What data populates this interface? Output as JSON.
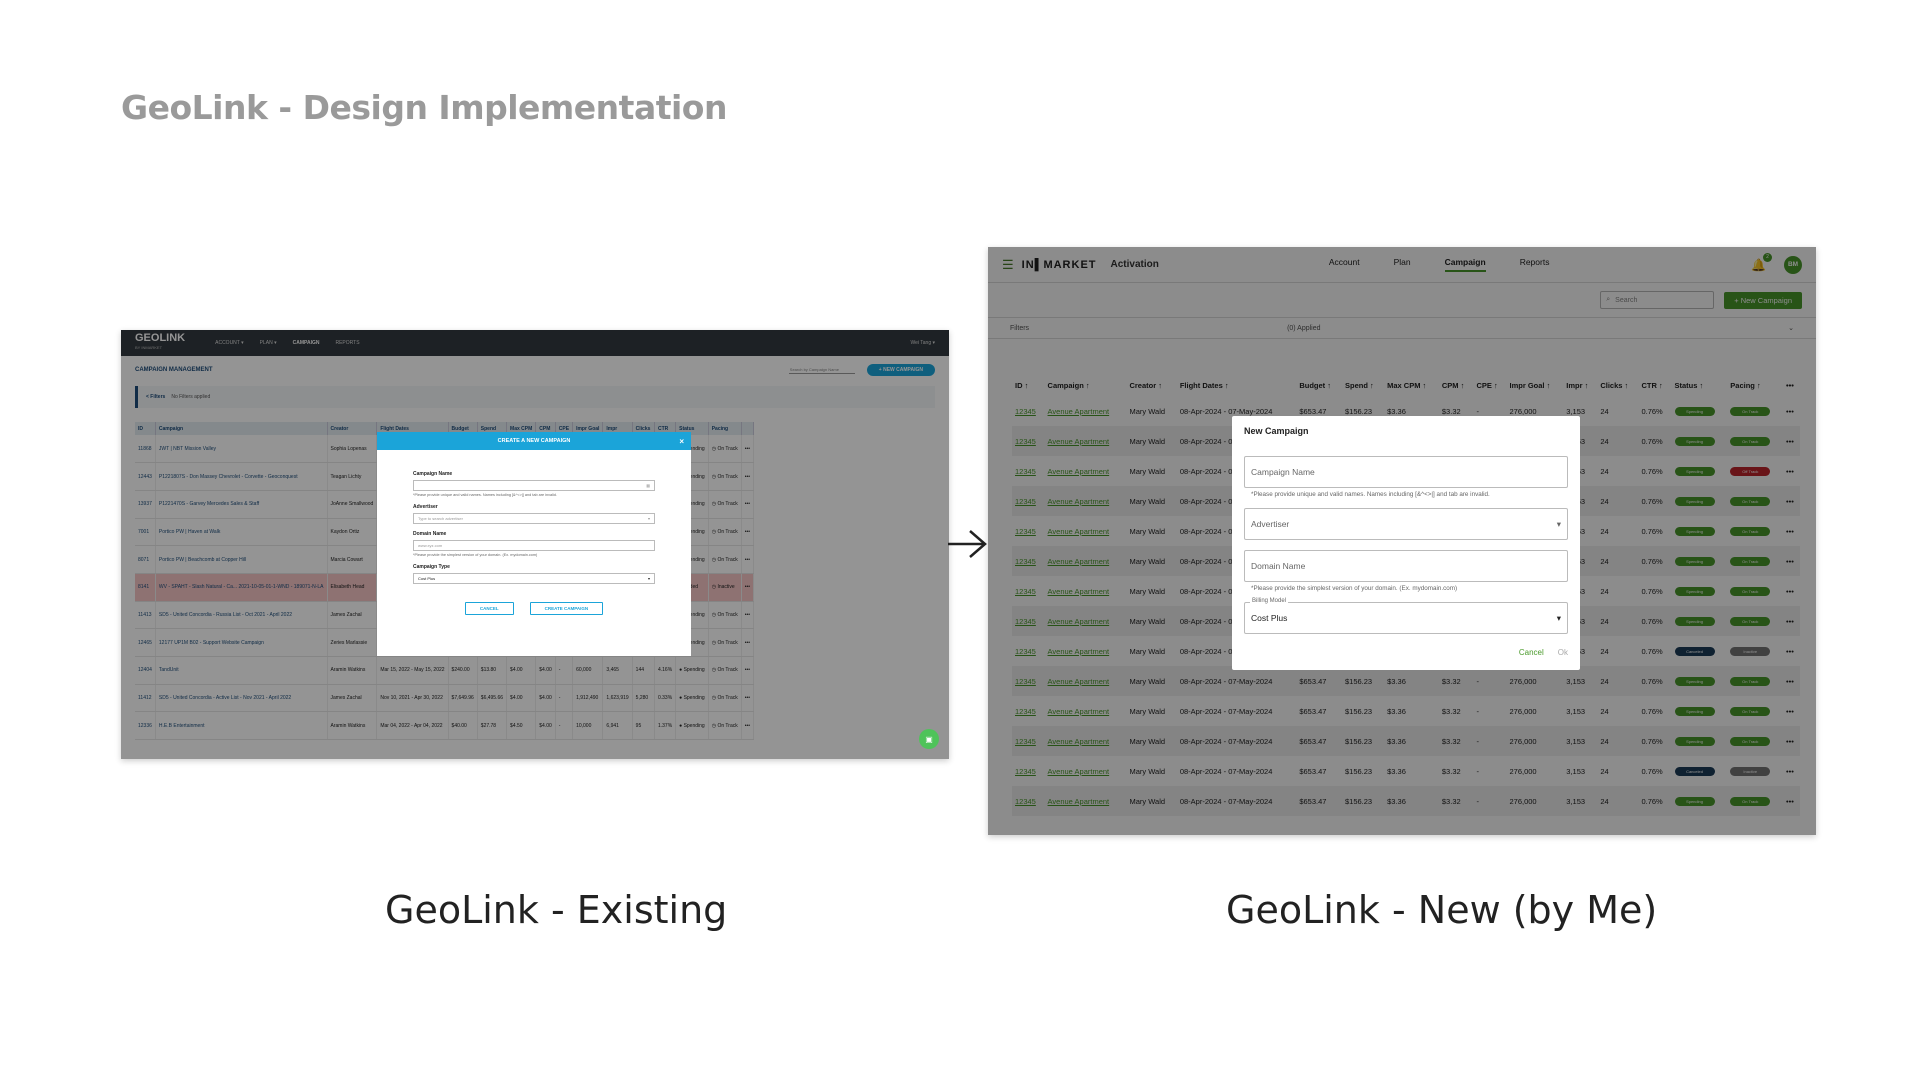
{
  "slide": {
    "title": "GeoLink - Design Implementation",
    "caption_left": "GeoLink - Existing",
    "caption_right": "GeoLink - New (by Me)"
  },
  "old": {
    "logo": "GEOLINK",
    "logo_sub": "BY INMARKET",
    "nav": [
      "ACCOUNT ▾",
      "PLAN ▾",
      "CAMPAIGN",
      "REPORTS"
    ],
    "user": "Wei Tang ▾",
    "section_title": "CAMPAIGN MANAGEMENT",
    "search_placeholder": "Search by Campaign Name",
    "new_button": "+ NEW CAMPAIGN",
    "filters_label": "< Filters",
    "filters_value": "No Filters applied",
    "columns": [
      "ID",
      "Campaign",
      "Creator",
      "Flight Dates",
      "Budget",
      "Spend",
      "Max CPM",
      "CPM",
      "CPE",
      "Impr Goal",
      "Impr",
      "Clicks",
      "CTR",
      "Status",
      "Pacing",
      ""
    ],
    "rows": [
      [
        "11868",
        "JWT | NBT Mission Valley",
        "Sophia Lopenas",
        "Jan 01, 2022 - Mar 31, 2022",
        "",
        "",
        "",
        "",
        "",
        "",
        "",
        "536",
        "0.06%",
        "● Spending",
        "◷ On Track",
        "•••"
      ],
      [
        "12443",
        "P1221807S - Don Massey Chevrolet - Corvette - Geoconquest",
        "Teagan Lichty",
        "Mar 23, 2022 - Mar 31, 2022",
        "",
        "",
        "",
        "",
        "",
        "",
        "",
        "312",
        "1.12%",
        "● Spending",
        "◷ On Track",
        "•••"
      ],
      [
        "13937",
        "P1221470S - Garvey Mercedes Sales & Staff",
        "JoAnne Smallwood",
        "Sep 06, 2021 - Mar 31, 2022",
        "",
        "",
        "",
        "",
        "",
        "",
        "",
        "3,862",
        "0.07%",
        "● Spending",
        "◷ On Track",
        "•••"
      ],
      [
        "7001",
        "Portico PW | Haven at Walk",
        "Kaydon Ortiz",
        "Feb 21, 2020 - Mar 31, 2022",
        "",
        "",
        "",
        "",
        "",
        "",
        "",
        "4,801",
        "0.77%",
        "● Spending",
        "◷ On Track",
        "•••"
      ],
      [
        "8071",
        "Portico PW | Beachcomb at Copper Hill",
        "Marcia Cowart",
        "Feb 01, 2021 - Mar 31, 2022",
        "",
        "",
        "",
        "",
        "",
        "",
        "",
        "3,297",
        "0.74%",
        "● Spending",
        "◷ On Track",
        "•••"
      ],
      [
        "8141",
        "WV - SPAHT - Slash Natural - Ca... 2021-10-05-01-1-WND - 189071-N-LA",
        "Elisabeth Head",
        "Jan 05, 2021 - Mar 31, 2022",
        "",
        "",
        "",
        "",
        "",
        "",
        "",
        "5,689",
        "0.06%",
        "● Ended",
        "◷ Inactive",
        "•••"
      ],
      [
        "11413",
        "SD5 - United Concordia - Russia List - Oct 2021 - April 2022",
        "James Zachal",
        "Nov 10, 2021 - Apr 30, 2022",
        "",
        "",
        "",
        "",
        "",
        "",
        "",
        "26,887",
        "0.27%",
        "● Spending",
        "◷ On Track",
        "•••"
      ],
      [
        "12465",
        "12177 UP1M B02 - Support Website Campaign",
        "Zeries Marlassie",
        "Mar 21, 2022 - Mar 31, 2022",
        "$1,750.00",
        "",
        "",
        "",
        "",
        "",
        "",
        "234",
        "0.91%",
        "● Spending",
        "◷ On Track",
        "•••"
      ],
      [
        "12404",
        "TandUnit",
        "Aramin Watkins",
        "Mar 15, 2022 - May 15, 2022",
        "$240.00",
        "$13.80",
        "$4.00",
        "$4.00",
        "-",
        "60,000",
        "3,465",
        "144",
        "4.16%",
        "● Spending",
        "◷ On Track",
        "•••"
      ],
      [
        "11412",
        "SD5 - United Concordia - Active List - Nov 2021 - April 2022",
        "James Zachal",
        "Nov 10, 2021 - Apr 30, 2022",
        "$7,649.96",
        "$6,495.66",
        "$4.00",
        "$4.00",
        "-",
        "1,912,490",
        "1,623,919",
        "5,280",
        "0.33%",
        "● Spending",
        "◷ On Track",
        "•••"
      ],
      [
        "12336",
        "H.E.B Entertainment",
        "Aramin Watkins",
        "Mar 04, 2022 - Apr 04, 2022",
        "$40.00",
        "$27.78",
        "$4.50",
        "$4.00",
        "-",
        "10,000",
        "6,941",
        "95",
        "1.37%",
        "● Spending",
        "◷ On Track",
        "•••"
      ]
    ],
    "modal": {
      "title": "CREATE A NEW CAMPAIGN",
      "close": "×",
      "campaign_name_label": "Campaign Name",
      "campaign_name_hint": "*Please provide unique and valid names. Names including [&^<>|] and tab are invalid.",
      "advertiser_label": "Advertiser",
      "advertiser_placeholder": "Type to search advertiser",
      "domain_label": "Domain Name",
      "domain_placeholder": "www.xyz.com",
      "domain_hint": "*Please provide the simplest version of your domain. (Ex. mydomain.com)",
      "type_label": "Campaign Type",
      "type_value": "Cost Plus",
      "cancel": "CANCEL",
      "create": "CREATE CAMPAIGN"
    }
  },
  "new": {
    "brand": "IN▌MARKET",
    "product": "Activation",
    "nav": [
      "Account",
      "Plan",
      "Campaign",
      "Reports"
    ],
    "notification_count": "2",
    "avatar": "BM",
    "search_placeholder": "Search",
    "new_button": "+ New Campaign",
    "filters_label": "Filters",
    "filters_applied": "(0) Applied",
    "columns": [
      "ID ↑",
      "Campaign ↑",
      "Creator ↑",
      "Flight Dates ↑",
      "Budget ↑",
      "Spend ↑",
      "Max CPM ↑",
      "CPM ↑",
      "CPE ↑",
      "Impr Goal ↑",
      "Impr ↑",
      "Clicks ↑",
      "CTR ↑",
      "Status ↑",
      "Pacing ↑",
      "•••"
    ],
    "row_template": {
      "id": "12345",
      "campaign": "Avenue Apartment",
      "creator": "Mary Wald",
      "flight": "08-Apr-2024 - 07-May-2024",
      "budget": "$653.47",
      "spend": "$156.23",
      "max_cpm": "$3.36",
      "cpm": "$3.32",
      "cpe": "-",
      "impr_goal": "276,000",
      "impr": "3,153",
      "clicks": "24",
      "ctr": "0.76%"
    },
    "rows_status": [
      [
        "Spending",
        "On Track"
      ],
      [
        "Spending",
        "On Track"
      ],
      [
        "Spending",
        "Off Track"
      ],
      [
        "Spending",
        "On Track"
      ],
      [
        "Spending",
        "On Track"
      ],
      [
        "Spending",
        "On Track"
      ],
      [
        "Spending",
        "On Track"
      ],
      [
        "Spending",
        "On Track"
      ],
      [
        "Canceled",
        "Inactive"
      ],
      [
        "Spending",
        "On Track"
      ],
      [
        "Spending",
        "On Track"
      ],
      [
        "Spending",
        "On Track"
      ],
      [
        "Canceled",
        "Inactive"
      ],
      [
        "Spending",
        "On Track"
      ]
    ],
    "status_colors": {
      "Spending": "#4a9a2b",
      "Canceled": "#1c3d5a",
      "On Track": "#4a9a2b",
      "Off Track": "#c0262d",
      "Inactive": "#777777"
    },
    "modal": {
      "title": "New Campaign",
      "campaign_name_placeholder": "Campaign Name",
      "campaign_name_hint": "*Please provide unique and valid names. Names including [&^<>|] and tab are invalid.",
      "advertiser_placeholder": "Advertiser",
      "domain_placeholder": "Domain Name",
      "domain_hint": "*Please provide the simplest version of your domain. (Ex. mydomain.com)",
      "billing_label": "Billing Model",
      "billing_value": "Cost Plus",
      "cancel": "Cancel",
      "ok": "Ok"
    }
  }
}
